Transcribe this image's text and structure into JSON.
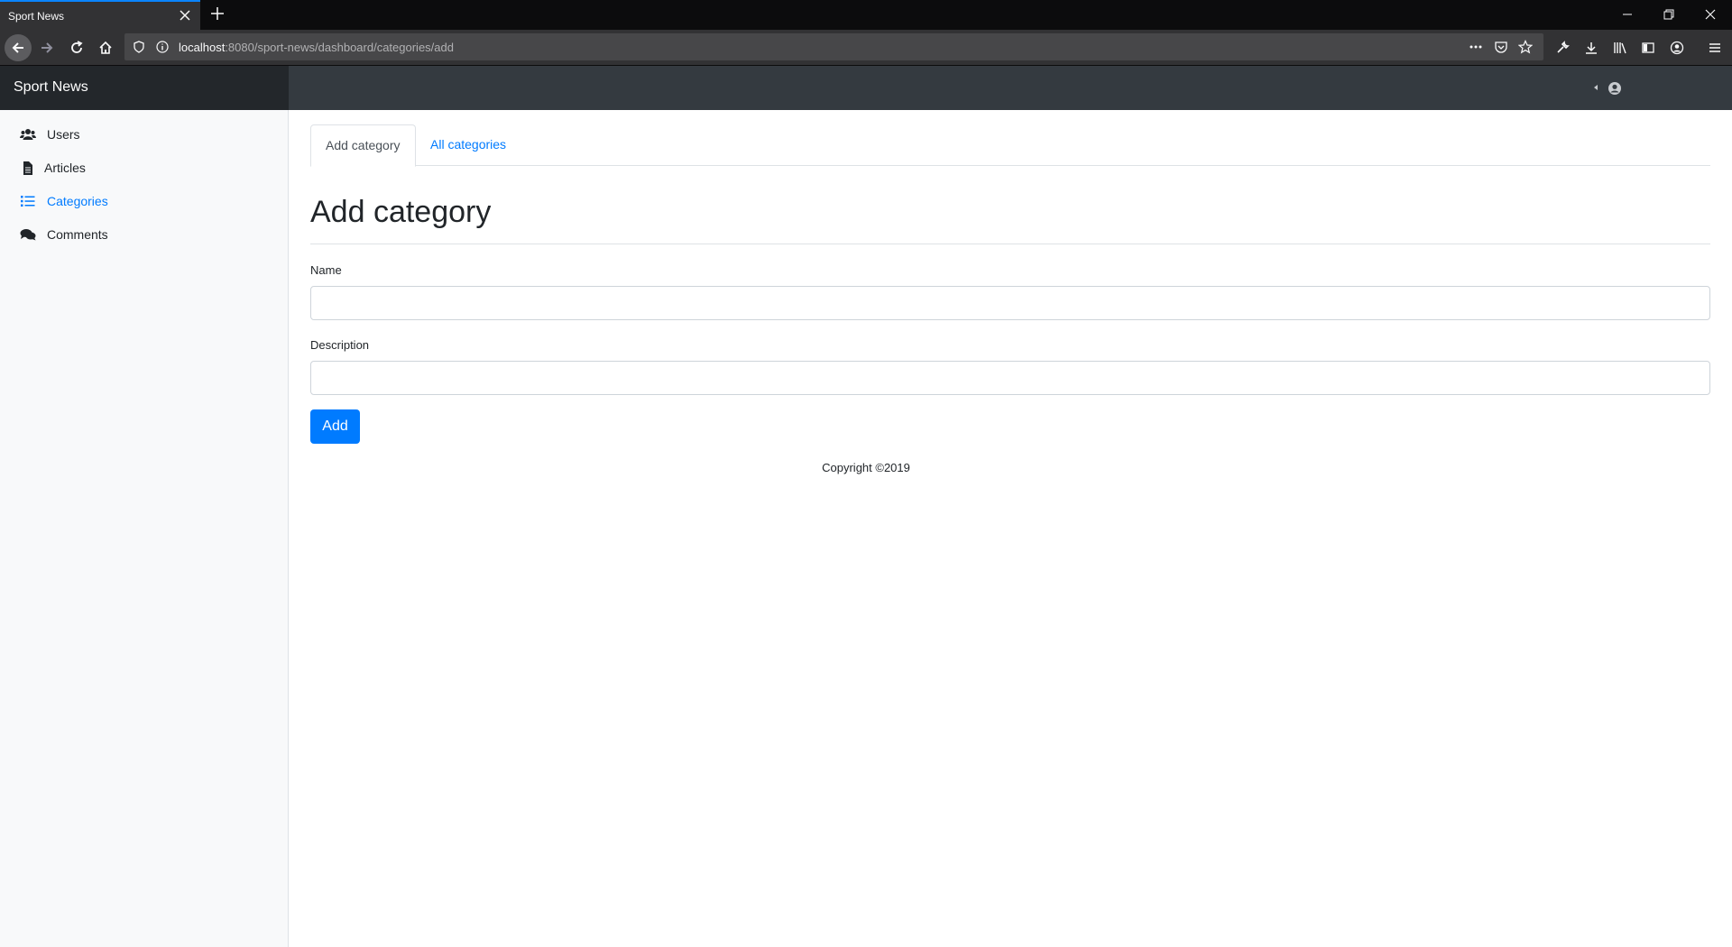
{
  "browser": {
    "tab_title": "Sport News",
    "url_host": "localhost",
    "url_rest": ":8080/sport-news/dashboard/categories/add"
  },
  "app": {
    "brand": "Sport News"
  },
  "sidebar": {
    "items": [
      {
        "label": "Users",
        "icon": "users-icon",
        "active": false
      },
      {
        "label": "Articles",
        "icon": "file-icon",
        "active": false
      },
      {
        "label": "Categories",
        "icon": "list-icon",
        "active": true
      },
      {
        "label": "Comments",
        "icon": "comments-icon",
        "active": false
      }
    ]
  },
  "tabs": {
    "add_category": "Add category",
    "all_categories": "All categories"
  },
  "form": {
    "title": "Add category",
    "name_label": "Name",
    "name_value": "",
    "description_label": "Description",
    "description_value": "",
    "submit_label": "Add"
  },
  "footer": {
    "text": "Copyright ©2019"
  },
  "colors": {
    "accent": "#007bff",
    "header_dark": "#343a40",
    "brand_dark": "#23272b",
    "sidebar_bg": "#f8f9fa"
  }
}
